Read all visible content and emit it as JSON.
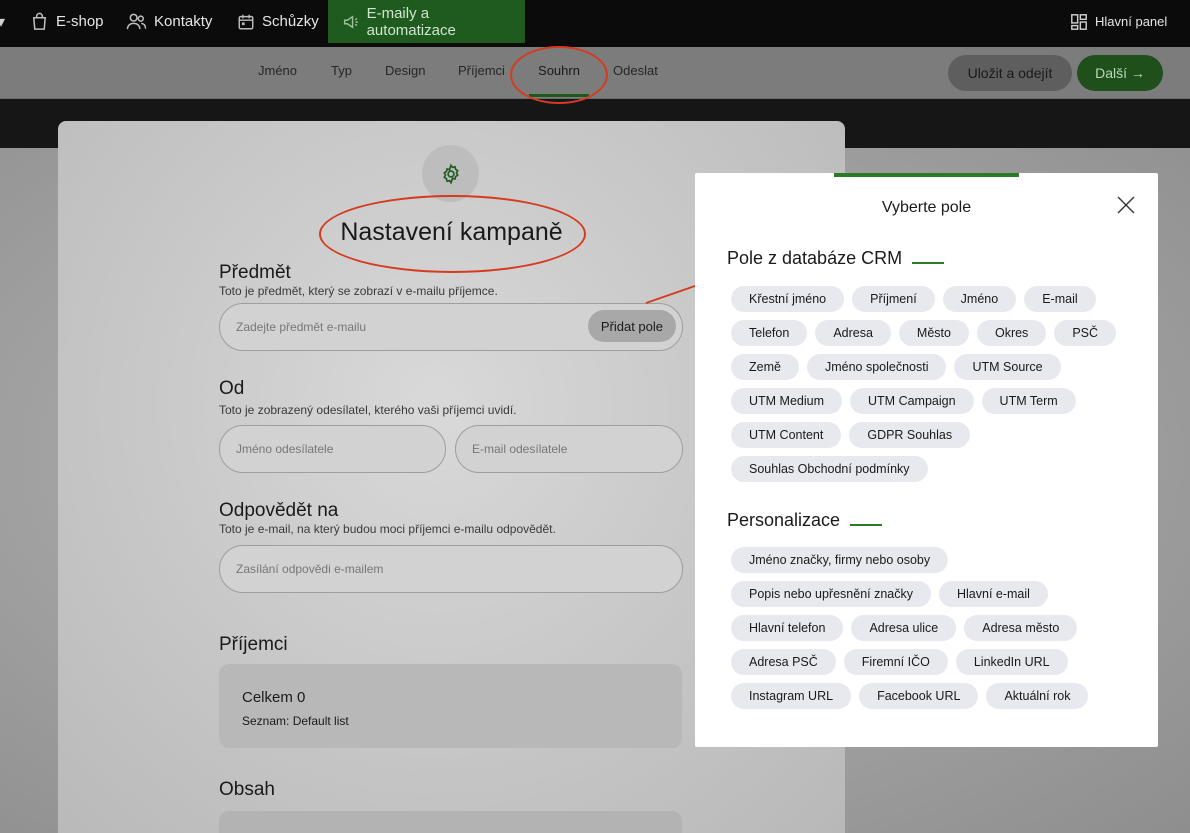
{
  "topnav": {
    "items": [
      {
        "label": "E-shop",
        "icon": "shopping-bag-icon"
      },
      {
        "label": "Kontakty",
        "icon": "users-icon"
      },
      {
        "label": "Schůzky",
        "icon": "calendar-icon"
      },
      {
        "label": "E-maily a automatizace",
        "icon": "megaphone-icon"
      }
    ],
    "dashboard_label": "Hlavní panel"
  },
  "subnav": {
    "tabs": [
      "Jméno",
      "Typ",
      "Design",
      "Příjemci",
      "Souhrn",
      "Odeslat"
    ],
    "active_tab": "Souhrn",
    "save_label": "Uložit a odejít",
    "next_label": "Další →"
  },
  "form": {
    "title": "Nastavení kampaně",
    "subject": {
      "title": "Předmět",
      "hint": "Toto je předmět, který se zobrazí v e-mailu příjemce.",
      "placeholder": "Zadejte předmět e-mailu",
      "add_field_label": "Přidat pole"
    },
    "from": {
      "title": "Od",
      "hint": "Toto je zobrazený odesílatel, kterého vaši příjemci uvidí.",
      "name_placeholder": "Jméno odesílatele",
      "email_placeholder": "E-mail odesílatele"
    },
    "reply_to": {
      "title": "Odpovědět na",
      "hint": "Toto je e-mail, na který budou moci příjemci e-mailu odpovědět.",
      "placeholder": "Zasílání odpovědi e-mailem"
    },
    "recipients": {
      "title": "Příjemci",
      "total": "Celkem 0",
      "list": "Seznam: Default list"
    },
    "content": {
      "title": "Obsah"
    }
  },
  "dialog": {
    "title": "Vyberte pole",
    "crm_title": "Pole z databáze CRM",
    "crm_fields": [
      "Křestní jméno",
      "Příjmení",
      "Jméno",
      "E-mail",
      "Telefon",
      "Adresa",
      "Město",
      "Okres",
      "PSČ",
      "Země",
      "Jméno společnosti",
      "UTM Source",
      "UTM Medium",
      "UTM Campaign",
      "UTM Term",
      "UTM Content",
      "GDPR Souhlas",
      "Souhlas Obchodní podmínky"
    ],
    "personal_title": "Personalizace",
    "personal_fields": [
      "Jméno značky, firmy nebo osoby",
      "Popis nebo upřesnění značky",
      "Hlavní e-mail",
      "Hlavní telefon",
      "Adresa ulice",
      "Adresa město",
      "Adresa PSČ",
      "Firemní IČO",
      "LinkedIn URL",
      "Instagram URL",
      "Facebook URL",
      "Aktuální rok"
    ]
  },
  "colors": {
    "accent_green": "#1f5a1f",
    "annotation_red": "#d63a1f"
  }
}
